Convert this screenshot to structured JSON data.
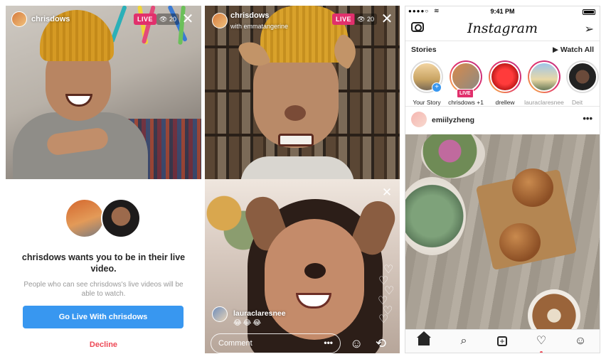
{
  "panel1": {
    "broadcaster": "chrisdows",
    "live_label": "LIVE",
    "viewer_count": "20",
    "invite": {
      "title": "chrisdows wants you to be in their live video.",
      "subtitle": "People who can see chrisdows's live videos will be able to watch.",
      "go_live_label": "Go Live With chrisdows",
      "decline_label": "Decline"
    }
  },
  "panel2": {
    "broadcaster": "chrisdows",
    "with_line": "with emmatangerine",
    "live_label": "LIVE",
    "viewer_count": "20",
    "guest_name": "lauraclaresnee",
    "guest_emoji": "😂😂😂",
    "comment_placeholder": "Comment",
    "comment_more": "•••"
  },
  "panel3": {
    "status": {
      "signal": "●●●●○",
      "time": "9:41 PM"
    },
    "logo": "Instagram",
    "stories_title": "Stories",
    "watch_all": "▶ Watch All",
    "stories": [
      {
        "label": "Your Story"
      },
      {
        "label": "chrisdows +1",
        "badge": "LIVE"
      },
      {
        "label": "drellew"
      },
      {
        "label": "lauraclaresnee"
      },
      {
        "label": "Deit"
      }
    ],
    "post": {
      "username": "emiilyzheng",
      "more": "•••"
    },
    "colors": {
      "live": "#e1306c",
      "primary": "#3897f0",
      "decline": "#ed4956"
    }
  },
  "icons": [
    "camera-icon",
    "send-icon",
    "home-icon",
    "search-icon",
    "add-icon",
    "heart-icon",
    "profile-icon",
    "close-icon",
    "eye-icon",
    "face-filter-icon",
    "flip-camera-icon"
  ]
}
